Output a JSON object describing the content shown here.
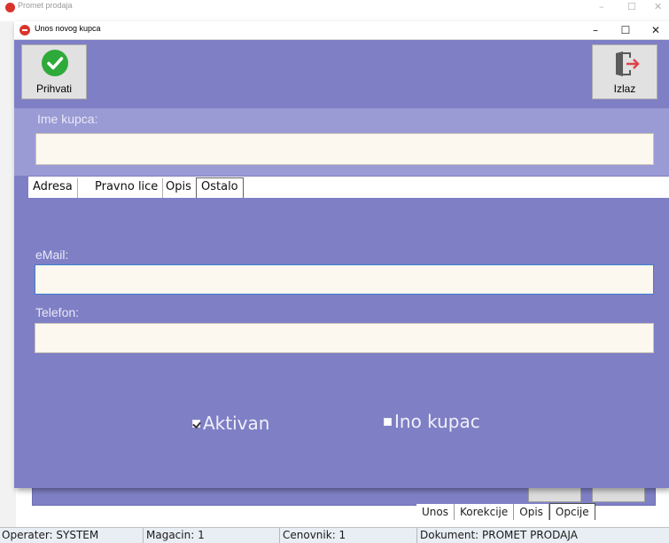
{
  "background_window": {
    "title": "Promet prodaja",
    "tabs": [
      {
        "label": "Unos"
      },
      {
        "label": "Korekcije"
      },
      {
        "label": "Opis"
      },
      {
        "label": "Opcije"
      }
    ],
    "status_bar": {
      "operater": "Operater: SYSTEM",
      "magacin": "Magacin: 1",
      "cenovnik": "Cenovnik: 1",
      "dokument": "Dokument: PROMET PRODAJA"
    }
  },
  "dialog": {
    "title": "Unos novog kupca",
    "controls": {
      "minimize": "–",
      "maximize": "☐",
      "close": "✕"
    },
    "toolbar": {
      "accept_label": "Prihvati",
      "exit_label": "Izlaz"
    },
    "form": {
      "ime_kupca_label": "Ime kupca:",
      "ime_kupca_value": "",
      "tabs": [
        {
          "label": "Adresa"
        },
        {
          "label": "Pravno lice"
        },
        {
          "label": "Opis"
        },
        {
          "label": "Ostalo",
          "active": true
        }
      ],
      "email_label": "eMail:",
      "email_value": "",
      "telefon_label": "Telefon:",
      "telefon_value": "",
      "aktivan_label": "Aktivan",
      "aktivan_checked": true,
      "ino_kupac_label": "Ino kupac",
      "ino_kupac_checked": false
    }
  },
  "colors": {
    "panel_purple": "#7f7fc5",
    "band_purple": "#9a9ad4",
    "input_bg": "#fdf8ef",
    "accept_green": "#2eaa3a",
    "exit_red": "#e0424a"
  },
  "icons": [
    "check-circle-icon",
    "exit-door-icon",
    "app-icon"
  ]
}
